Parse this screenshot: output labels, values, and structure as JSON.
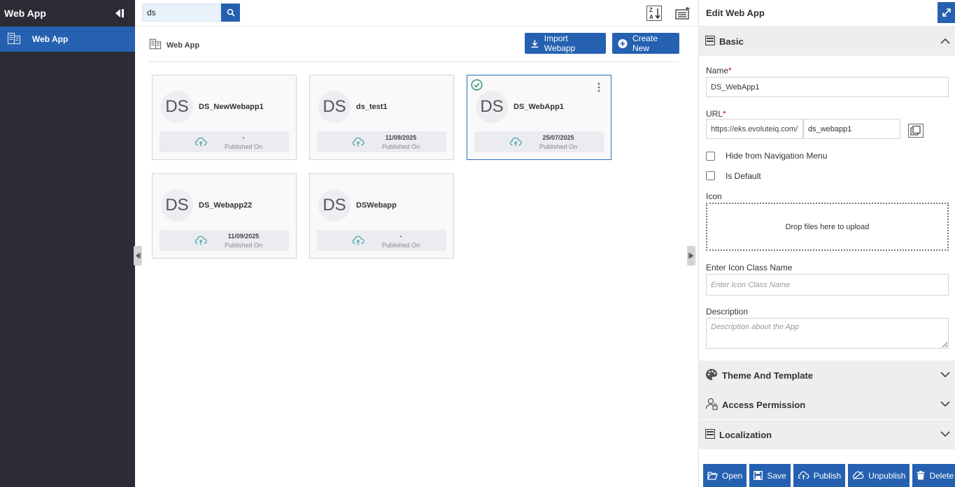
{
  "sidebar": {
    "title": "Web App",
    "items": [
      {
        "label": "Web App"
      }
    ]
  },
  "search": {
    "value": "ds",
    "placeholder": ""
  },
  "breadcrumb": {
    "label": "Web App"
  },
  "actions": {
    "import_label": "Import Webapp",
    "create_label": "Create New"
  },
  "cards": [
    {
      "initials": "DS",
      "name": "DS_NewWebapp1",
      "date": "-",
      "published_label": "Published On"
    },
    {
      "initials": "DS",
      "name": "ds_test1",
      "date": "11/09/2025",
      "published_label": "Published On"
    },
    {
      "initials": "DS",
      "name": "DS_WebApp1",
      "date": "25/07/2025",
      "published_label": "Published On"
    },
    {
      "initials": "DS",
      "name": "DS_Webapp22",
      "date": "11/09/2025",
      "published_label": "Published On"
    },
    {
      "initials": "DS",
      "name": "DSWebapp",
      "date": "-",
      "published_label": "Published On"
    }
  ],
  "panel": {
    "title": "Edit Web App",
    "sections": {
      "basic": "Basic",
      "theme": "Theme And Template",
      "access": "Access Permission",
      "localization": "Localization"
    },
    "name_label": "Name",
    "name_value": "DS_WebApp1",
    "url_label": "URL",
    "url_prefix": "https://eks.evoluteiq.com/",
    "url_slug": "ds_webapp1",
    "hide_nav_label": "Hide from Navigation Menu",
    "is_default_label": "Is Default",
    "icon_label": "Icon",
    "dropzone_text": "Drop files here to upload",
    "icon_class_label": "Enter Icon Class Name",
    "icon_class_placeholder": "Enter Icon Class Name",
    "description_label": "Description",
    "description_placeholder": "Description about the App",
    "required_mark": "*"
  },
  "footer": {
    "open": "Open",
    "save": "Save",
    "publish": "Publish",
    "unpublish": "Unpublish",
    "delete": "Delete"
  },
  "colors": {
    "primary": "#2561b0",
    "sidebar": "#2b2c36",
    "check": "#2e9e6b",
    "cloud": "#3aa1a1"
  }
}
